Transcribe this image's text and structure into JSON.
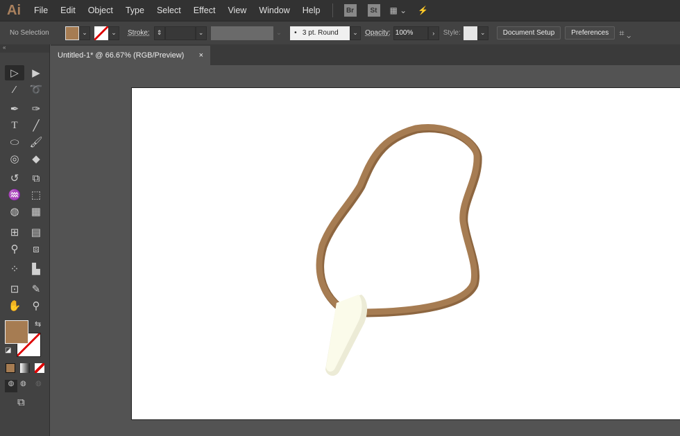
{
  "app": {
    "logo": "Ai"
  },
  "menu": [
    "File",
    "Edit",
    "Object",
    "Type",
    "Select",
    "Effect",
    "View",
    "Window",
    "Help"
  ],
  "menu_icons": {
    "bridge": "Br",
    "stock": "St"
  },
  "control": {
    "selection": "No Selection",
    "fill_color": "#a67c52",
    "stroke_label": "Stroke:",
    "brush": "3 pt. Round",
    "opacity_label": "Opacity:",
    "opacity": "100%",
    "style_label": "Style:",
    "document_setup": "Document Setup",
    "preferences": "Preferences"
  },
  "tab": {
    "title": "Untitled-1* @ 66.67% (RGB/Preview)",
    "close": "×"
  },
  "tools": [
    "selection",
    "direct-selection",
    "magic-wand",
    "lasso",
    "pen",
    "curvature",
    "type",
    "line",
    "ellipse",
    "paintbrush",
    "shaper",
    "eraser",
    "rotate",
    "scale",
    "warp",
    "free-transform",
    "shape-builder",
    "perspective-grid",
    "mesh",
    "gradient",
    "eyedropper",
    "blend",
    "symbol-sprayer",
    "column-graph",
    "artboard",
    "slice",
    "hand",
    "zoom"
  ],
  "colors": {
    "cord": "#a67c52",
    "cord_dark": "#8d6640",
    "tooth": "#fbfbea",
    "tooth_shade": "#ecebd6"
  }
}
